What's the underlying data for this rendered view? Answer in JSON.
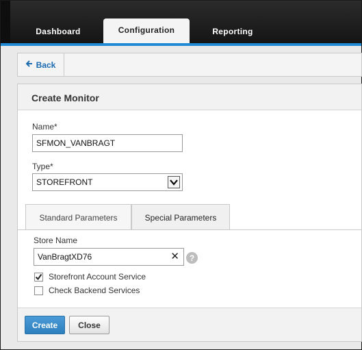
{
  "nav": {
    "tabs": [
      {
        "label": "Dashboard",
        "active": false
      },
      {
        "label": "Configuration",
        "active": true
      },
      {
        "label": "Reporting",
        "active": false
      }
    ],
    "accent_color": "#1f8ad3"
  },
  "back": {
    "label": "Back",
    "icon": "arrow-left-icon"
  },
  "panel": {
    "title": "Create Monitor",
    "name_label": "Name*",
    "name_value": "SFMON_VANBRAGT",
    "type_label": "Type*",
    "type_value": "STOREFRONT",
    "param_tabs": [
      {
        "label": "Standard Parameters",
        "active": false
      },
      {
        "label": "Special Parameters",
        "active": true
      }
    ],
    "store_name_label": "Store Name",
    "store_name_value": "VanBragtXD76",
    "checkboxes": [
      {
        "label": "Storefront Account Service",
        "checked": true
      },
      {
        "label": "Check Backend Services",
        "checked": false
      }
    ]
  },
  "footer": {
    "create_label": "Create",
    "close_label": "Close"
  }
}
